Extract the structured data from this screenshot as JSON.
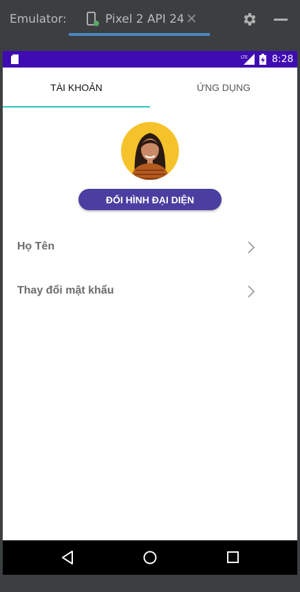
{
  "emulator": {
    "label": "Emulator:",
    "tab_title": "Pixel 2 API 24",
    "icons": [
      "device-icon",
      "close-icon",
      "gear-icon",
      "minimize-icon"
    ]
  },
  "status_bar": {
    "time": "8:28",
    "network": "LTE",
    "color": "#3f0bb2"
  },
  "tabs": [
    {
      "label": "TÀI KHOẢN",
      "active": true
    },
    {
      "label": "ỨNG DỤNG",
      "active": false
    }
  ],
  "accent_color": "#2ec3c3",
  "button_color": "#4a3fa0",
  "profile": {
    "change_avatar_label": "ĐỔI HÌNH ĐẠI DIỆN"
  },
  "menu": [
    {
      "label": "Họ Tên"
    },
    {
      "label": "Thay đổi mật khẩu"
    }
  ],
  "nav_bar": {
    "icons": [
      "back-icon",
      "home-icon",
      "recent-apps-icon"
    ]
  }
}
